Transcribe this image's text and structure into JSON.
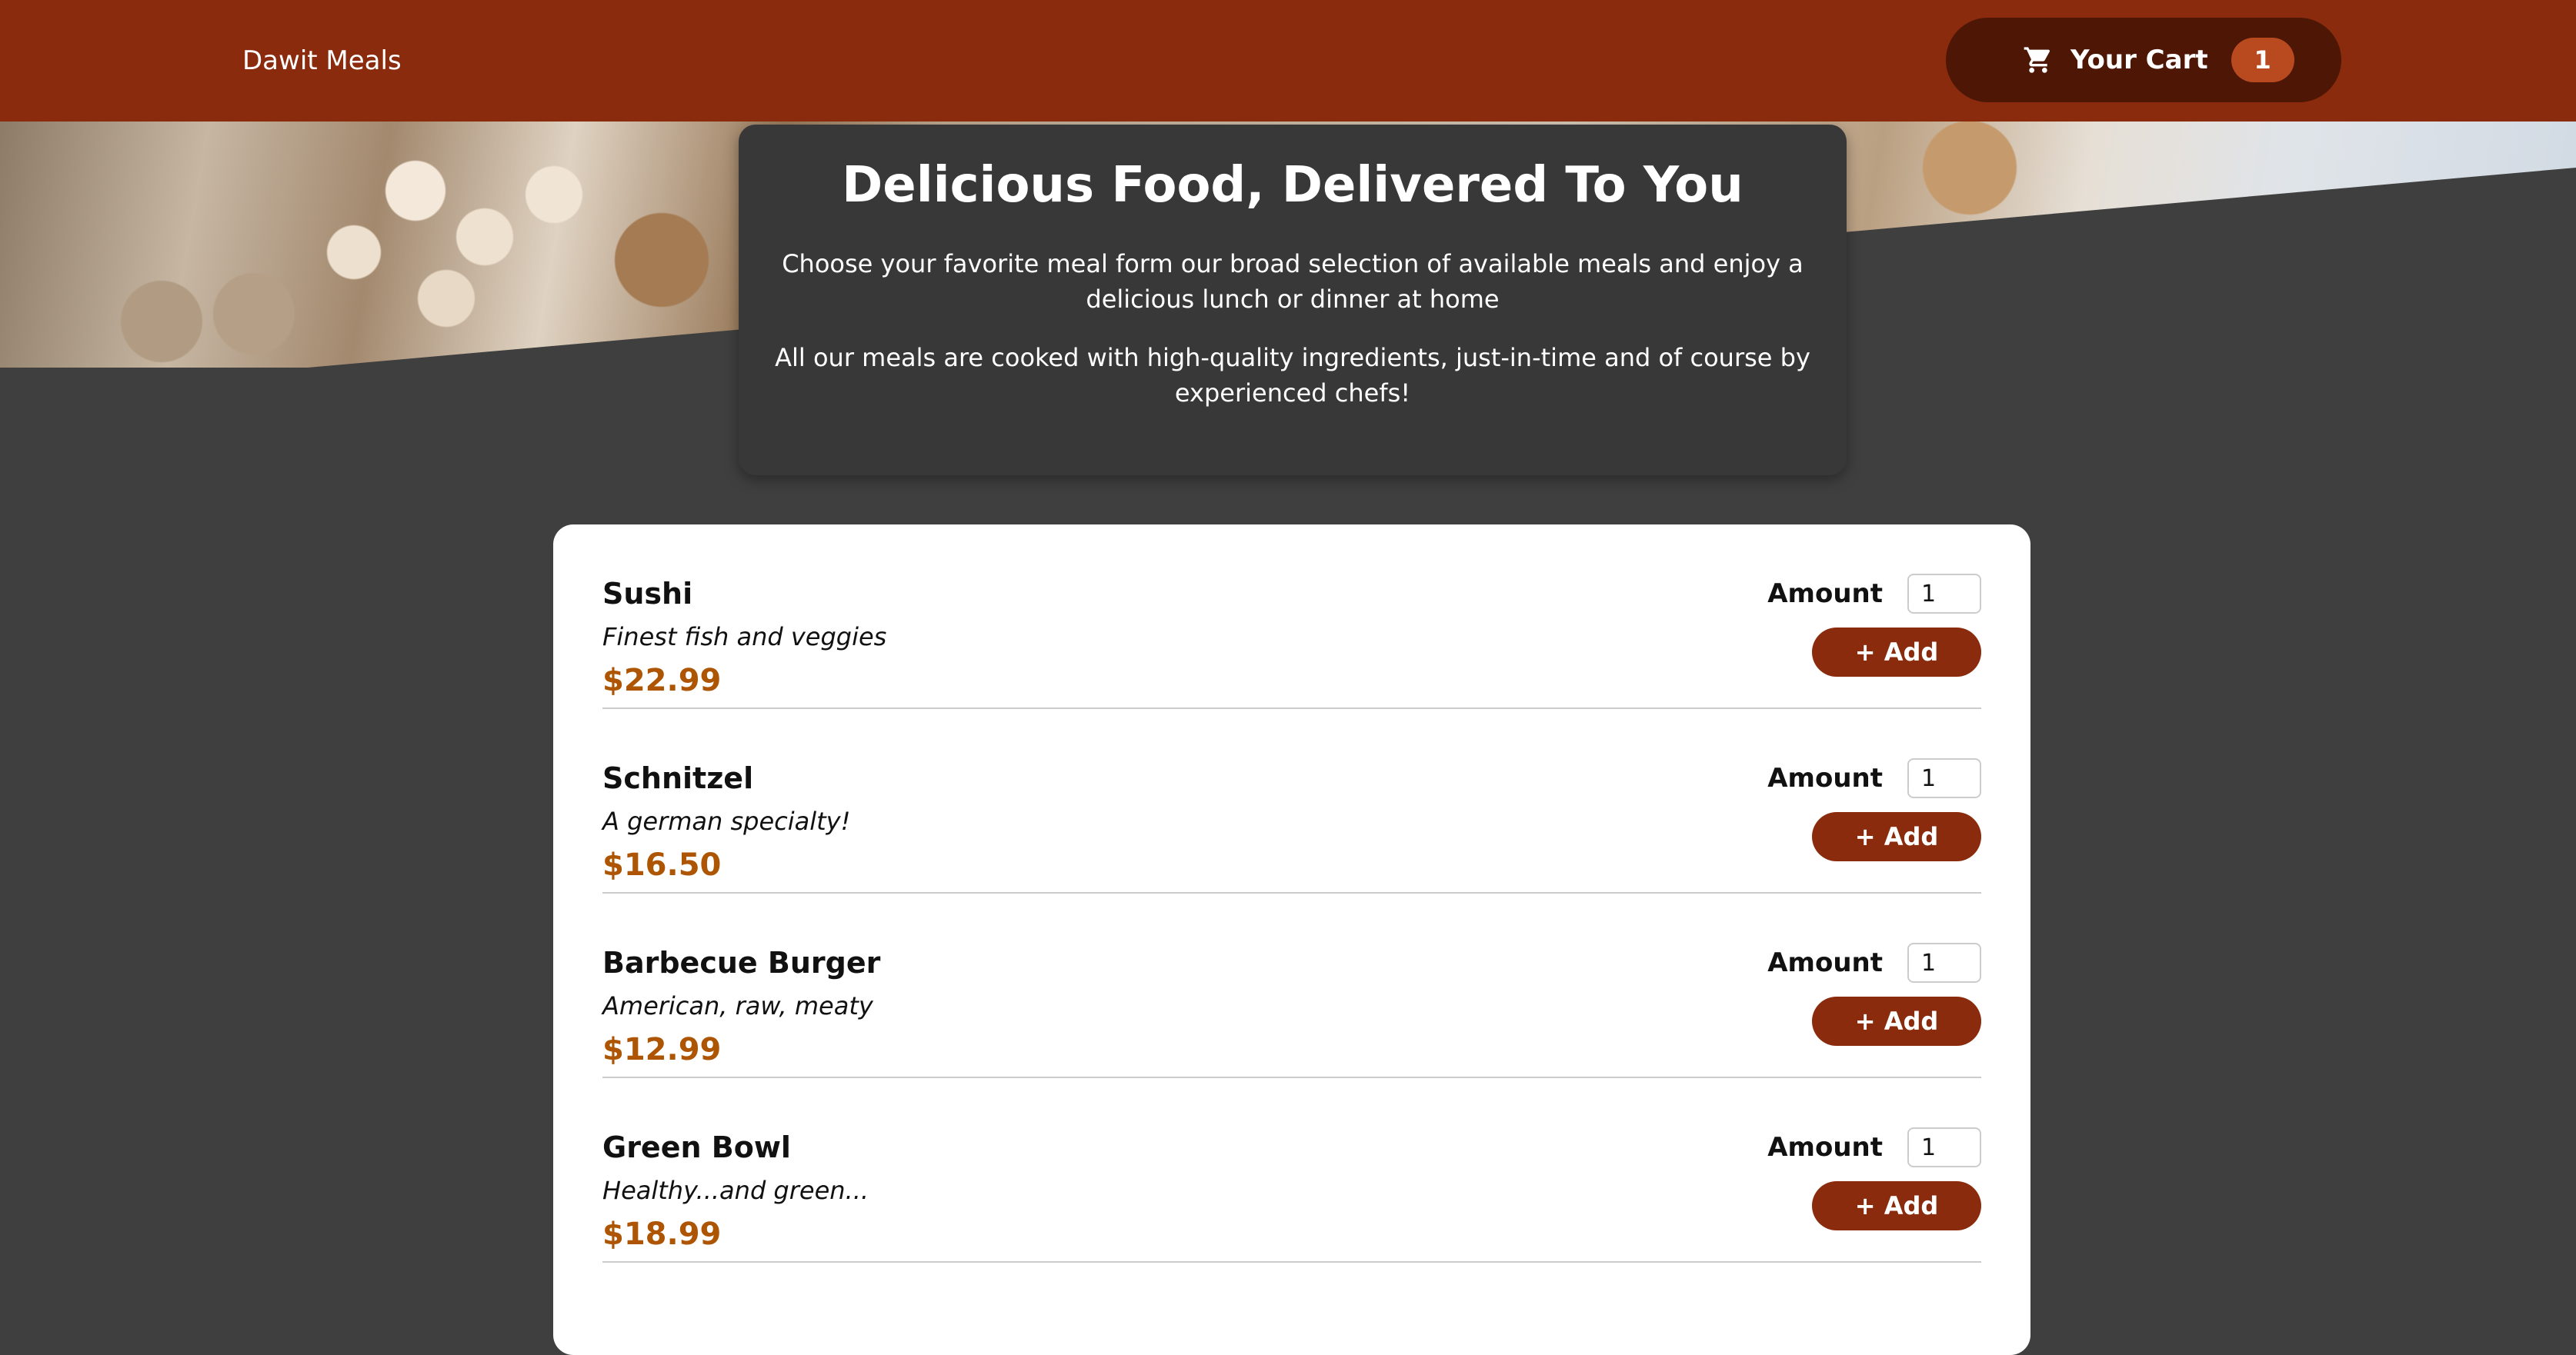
{
  "header": {
    "brand": "Dawit Meals",
    "cart": {
      "label": "Your Cart",
      "count": "1",
      "icon": "cart-icon"
    }
  },
  "summary": {
    "title": "Delicious Food, Delivered To You",
    "paragraph1": "Choose your favorite meal form our broad selection of available meals and enjoy a delicious lunch or dinner at home",
    "paragraph2": "All our meals are cooked with high-quality ingredients, just-in-time and of course by experienced chefs!"
  },
  "meals": [
    {
      "name": "Sushi",
      "description": "Finest fish and veggies",
      "price": "$22.99",
      "amount_label": "Amount",
      "amount": "1",
      "add_label": "+ Add"
    },
    {
      "name": "Schnitzel",
      "description": "A german specialty!",
      "price": "$16.50",
      "amount_label": "Amount",
      "amount": "1",
      "add_label": "+ Add"
    },
    {
      "name": "Barbecue Burger",
      "description": "American, raw, meaty",
      "price": "$12.99",
      "amount_label": "Amount",
      "amount": "1",
      "add_label": "+ Add"
    },
    {
      "name": "Green Bowl",
      "description": "Healthy...and green...",
      "price": "$18.99",
      "amount_label": "Amount",
      "amount": "1",
      "add_label": "+ Add"
    }
  ],
  "colors": {
    "header_bg": "#8a2b0e",
    "cart_button_bg": "#4d1605",
    "badge_bg": "#b94a20",
    "page_bg": "#3f3f3f",
    "price": "#ad5502"
  }
}
